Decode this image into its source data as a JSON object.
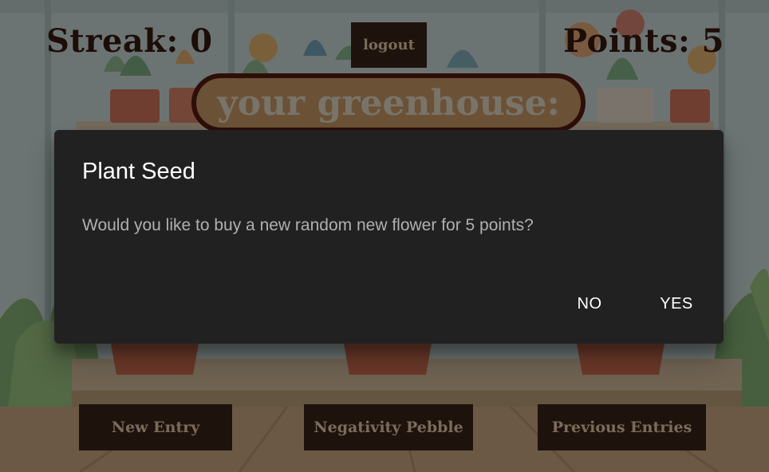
{
  "hud": {
    "streak": "Streak: 0",
    "points": "Points: 5",
    "logout_label": "logout"
  },
  "banner": {
    "text": "your greenhouse:"
  },
  "nav": {
    "new_entry": "New Entry",
    "negativity_pebble": "Negativity Pebble",
    "previous_entries": "Previous Entries"
  },
  "dialog": {
    "title": "Plant Seed",
    "message": "Would you like to buy a new random new flower for 5 points?",
    "no_label": "NO",
    "yes_label": "YES"
  }
}
